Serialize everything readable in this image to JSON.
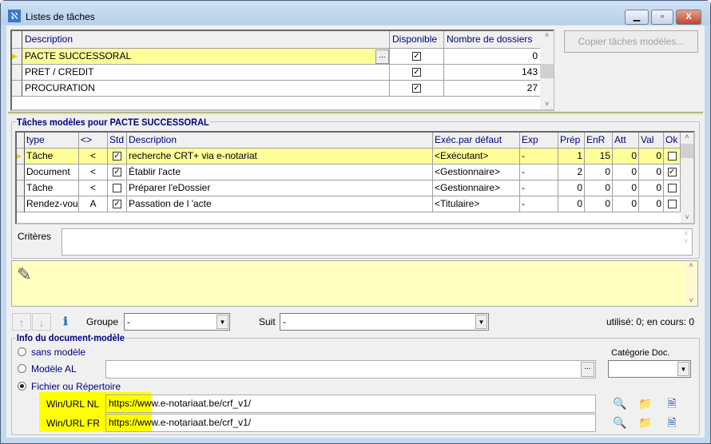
{
  "window": {
    "title": "Listes de tâches",
    "minimize": "▁",
    "maximize": "▫",
    "close": "X"
  },
  "top_grid": {
    "columns": [
      "Description",
      "Disponible",
      "Nombre de dossiers"
    ],
    "rows": [
      {
        "description": "PACTE SUCCESSORAL",
        "disponible": true,
        "count": "0",
        "selected": true
      },
      {
        "description": "PRET / CREDIT",
        "disponible": true,
        "count": "143"
      },
      {
        "description": "PROCURATION",
        "disponible": true,
        "count": "27"
      }
    ],
    "ellipsis": "..."
  },
  "copy_button": "Copier tâches modèles...",
  "tasks": {
    "title": "Tâches modèles pour PACTE SUCCESSORAL",
    "columns": [
      "type",
      "<>",
      "Std",
      "Description",
      "Exéc.par défaut",
      "Exp",
      "Prép",
      "EnR",
      "Att",
      "Val",
      "Ok"
    ],
    "rows": [
      {
        "type": "Tâche",
        "dir": "<",
        "std": true,
        "description": "recherche CRT+ via e-notariat",
        "exec": "<Exécutant>",
        "exp": "-",
        "prep": "1",
        "enr": "15",
        "att": "0",
        "val": "0",
        "ok": false,
        "selected": true
      },
      {
        "type": "Document",
        "dir": "<",
        "std": true,
        "description": "Établir l'acte",
        "exec": "<Gestionnaire>",
        "exp": "-",
        "prep": "2",
        "enr": "0",
        "att": "0",
        "val": "0",
        "ok": true
      },
      {
        "type": "Tâche",
        "dir": "<",
        "std": false,
        "description": "Préparer l'eDossier",
        "exec": "<Gestionnaire>",
        "exp": "-",
        "prep": "0",
        "enr": "0",
        "att": "0",
        "val": "0",
        "ok": false
      },
      {
        "type": "Rendez-vous",
        "dir": "A",
        "std": true,
        "description": "Passation de l 'acte",
        "exec": "<Titulaire>",
        "exp": "-",
        "prep": "0",
        "enr": "0",
        "att": "0",
        "val": "0",
        "ok": false
      }
    ]
  },
  "criteres": {
    "label": "Critères",
    "value": ""
  },
  "toolbar": {
    "groupe_label": "Groupe",
    "groupe_value": "-",
    "suit_label": "Suit",
    "suit_value": "-",
    "status": "utilisé: 0; en cours: 0"
  },
  "doc_info": {
    "title": "Info du document-modèle",
    "options": [
      "sans modèle",
      "Modèle AL",
      "Fichier ou Répertoire"
    ],
    "selected": "Fichier ou Répertoire",
    "modele_al_value": "",
    "categorie_label": "Catégorie Doc.",
    "categorie_value": "",
    "url_nl_label": "Win/URL NL",
    "url_nl": "https://www.e-notariaat.be/crf_v1/",
    "url_fr_label": "Win/URL FR",
    "url_fr": "https://www.e-notariaat.be/crf_v1/"
  },
  "colors": {
    "selection": "#ffff99",
    "highlight": "#ffff00",
    "header_text": "#000080"
  }
}
